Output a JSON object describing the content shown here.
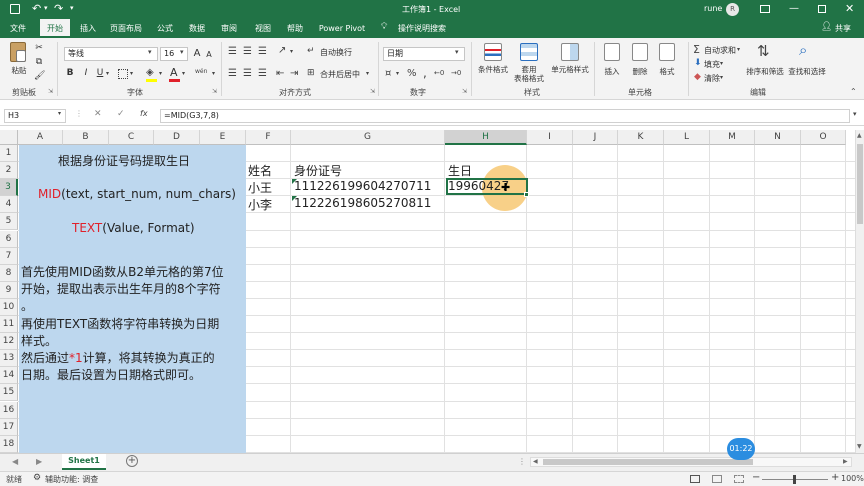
{
  "title_bar": {
    "title": "工作簿1 - Excel",
    "user": "rune",
    "avatar": "R"
  },
  "tabs": [
    "文件",
    "开始",
    "插入",
    "页面布局",
    "公式",
    "数据",
    "审阅",
    "视图",
    "帮助",
    "Power Pivot"
  ],
  "tell_me": "操作说明搜索",
  "share": "共享",
  "ribbon": {
    "clipboard": {
      "paste": "粘贴",
      "group": "剪贴板"
    },
    "font": {
      "name": "等线",
      "size": "16",
      "bold": "B",
      "italic": "I",
      "underline": "U",
      "grow": "A",
      "shrink": "A",
      "wen": "wén",
      "group": "字体"
    },
    "alignment": {
      "wrap": "自动换行",
      "merge": "合并后居中",
      "group": "对齐方式"
    },
    "number": {
      "format": "日期",
      "percent": "%",
      "comma": ",",
      "group": "数字"
    },
    "styles": {
      "conditional": "条件格式",
      "table": "套用\n表格格式",
      "cell": "单元格样式",
      "group": "样式"
    },
    "cells": {
      "insert": "插入",
      "delete": "删除",
      "format": "格式",
      "group": "单元格"
    },
    "editing": {
      "autosum": "自动求和",
      "fill": "填充",
      "clear": "清除",
      "sort": "排序和筛选",
      "find": "查找和选择",
      "group": "编辑"
    }
  },
  "formula_bar": {
    "name_box": "H3",
    "fx": "fx",
    "formula": "=MID(G3,7,8)"
  },
  "columns": [
    "A",
    "B",
    "C",
    "D",
    "E",
    "F",
    "G",
    "H",
    "I",
    "J",
    "K",
    "L",
    "M",
    "N",
    "O"
  ],
  "rows": [
    "1",
    "2",
    "3",
    "4",
    "5",
    "6",
    "7",
    "8",
    "9",
    "10",
    "11",
    "12",
    "13",
    "14",
    "15",
    "16",
    "17",
    "18"
  ],
  "panel": {
    "heading": "根据身份证号码提取生日",
    "mid_fn": "MID",
    "mid_args": "(text, start_num, num_chars)",
    "text_fn": "TEXT",
    "text_args": "(Value, Format)",
    "line1": "首先使用MID函数从B2单元格的第7位",
    "line2": "开始，提取出表示出生年月的8个字符",
    "line3": "。",
    "line4": "再使用TEXT函数将字符串转换为日期",
    "line5": "样式。",
    "line6a": "然后通过",
    "line6b": "*1",
    "line6c": "计算，将其转换为真正的",
    "line7": "日期。最后设置为日期格式即可。"
  },
  "table": {
    "headers": {
      "name": "姓名",
      "id": "身份证号",
      "birthday": "生日"
    },
    "rows": [
      {
        "name": "小王",
        "id": "111226199604270711",
        "birthday": "19960427"
      },
      {
        "name": "小李",
        "id": "112226198605270811",
        "birthday": ""
      }
    ]
  },
  "sheet_tab": "Sheet1",
  "status": {
    "mode": "就绪",
    "accessibility": "辅助功能: 调查",
    "zoom": "100%",
    "timer": "01:22"
  },
  "colors": {
    "accent": "#217346",
    "panel": "#bdd7ee",
    "highlight": "#f7c873"
  }
}
